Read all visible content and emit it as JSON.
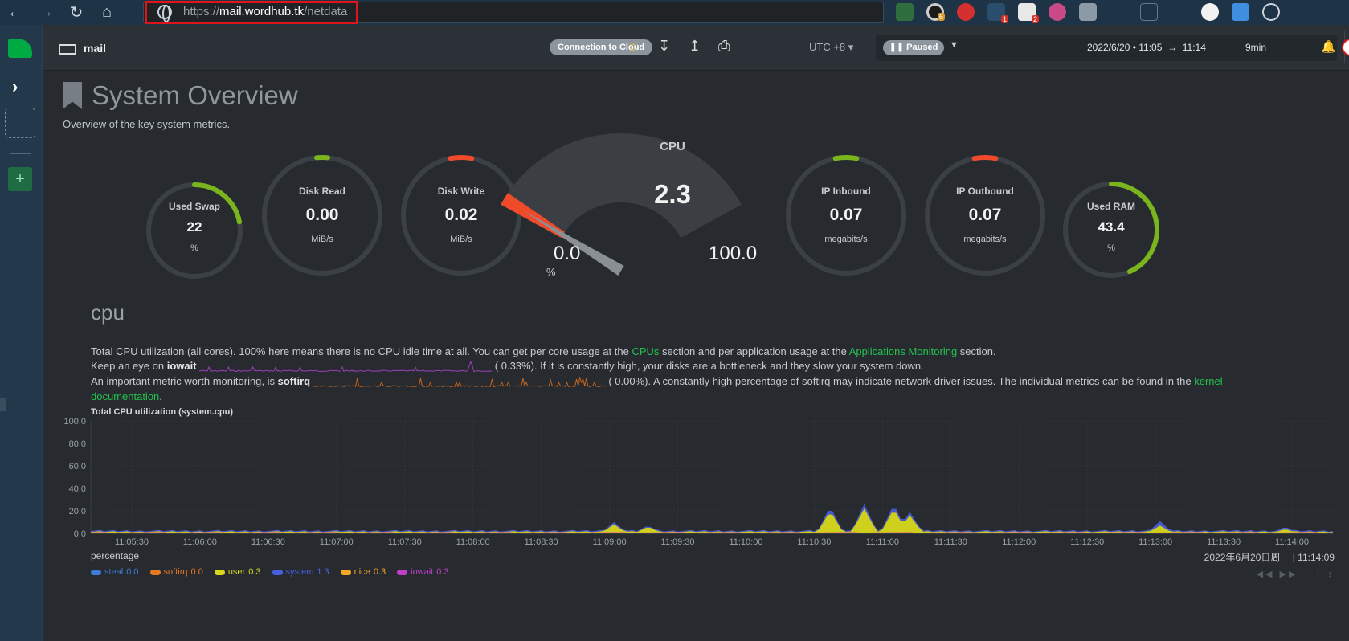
{
  "browser": {
    "url_domain": "mail.wordhub.tk",
    "url_prefix": "https://",
    "url_path": "/netdata",
    "extension_badges": [
      "6",
      "1",
      "2"
    ]
  },
  "header": {
    "host": "mail",
    "cloud_button": "Connection to Cloud",
    "timezone": "UTC +8",
    "paused_label": "Paused",
    "time_range_start": "2022/6/20 • 11:05",
    "time_range_arrow": "→",
    "time_range_end": "11:14",
    "duration": "9min"
  },
  "page": {
    "title": "System Overview",
    "subtitle": "Overview of the key system metrics."
  },
  "gauges": {
    "used_swap": {
      "label": "Used Swap",
      "value": "22",
      "unit": "%",
      "fraction": 0.22,
      "color": "#7ab51d"
    },
    "disk_read": {
      "label": "Disk Read",
      "value": "0.00",
      "unit": "MiB/s",
      "fraction": 0.0,
      "color": "#7ab51d"
    },
    "disk_write": {
      "label": "Disk Write",
      "value": "0.02",
      "unit": "MiB/s",
      "fraction": 0.04,
      "color": "#ef4b2b"
    },
    "cpu": {
      "label": "CPU",
      "value": "2.3",
      "min": "0.0",
      "max": "100.0",
      "unit": "%",
      "fraction": 0.023
    },
    "ip_inbound": {
      "label": "IP Inbound",
      "value": "0.07",
      "unit": "megabits/s",
      "fraction": 0.04,
      "color": "#7ab51d"
    },
    "ip_outbound": {
      "label": "IP Outbound",
      "value": "0.07",
      "unit": "megabits/s",
      "fraction": 0.04,
      "color": "#ef4b2b"
    },
    "used_ram": {
      "label": "Used RAM",
      "value": "43.4",
      "unit": "%",
      "fraction": 0.434,
      "color": "#7ab51d"
    }
  },
  "cpu_section": {
    "title": "cpu",
    "line1_a": "Total CPU utilization (all cores). 100% here means there is no CPU idle time at all. You can get per core usage at the ",
    "line1_link1": "CPUs",
    "line1_b": " section and per application usage at the ",
    "line1_link2": "Applications Monitoring",
    "line1_c": " section.",
    "line2_a": "Keep an eye on ",
    "line2_bold": "iowait",
    "line2_value": "(      0.33%). If it is constantly high, your disks are a bottleneck and they slow your system down.",
    "line3_a": "An important metric worth monitoring, is ",
    "line3_bold": "softirq",
    "line3_value": "(      0.00%). A constantly high percentage of softirq may indicate network driver issues. The individual metrics can be found in the ",
    "line3_link": "kernel",
    "line4_link": "documentation",
    "line4_end": "."
  },
  "chart_data": {
    "type": "area",
    "title": "Total CPU utilization (system.cpu)",
    "ylabel": "percentage",
    "ylim": [
      0,
      100
    ],
    "yticks": [
      "100.0",
      "80.0",
      "60.0",
      "40.0",
      "20.0",
      "0.0"
    ],
    "x": [
      "11:05:30",
      "11:06:00",
      "11:06:30",
      "11:07:00",
      "11:07:30",
      "11:08:00",
      "11:08:30",
      "11:09:00",
      "11:09:30",
      "11:10:00",
      "11:10:30",
      "11:11:00",
      "11:11:30",
      "11:12:00",
      "11:12:30",
      "11:13:00",
      "11:13:30",
      "11:14:00"
    ],
    "date_label": "2022年6月20日周一 | 11:14:09",
    "series": [
      {
        "name": "steal",
        "value": "0.0",
        "color": "#3e7bd6"
      },
      {
        "name": "softirq",
        "value": "0.0",
        "color": "#e87722"
      },
      {
        "name": "user",
        "value": "0.3",
        "color": "#d8d81c"
      },
      {
        "name": "system",
        "value": "1.3",
        "color": "#4a5fe0"
      },
      {
        "name": "nice",
        "value": "0.3",
        "color": "#f5a623"
      },
      {
        "name": "iowait",
        "value": "0.3",
        "color": "#c13fc6"
      }
    ],
    "spikes": [
      {
        "t": "11:09:02",
        "user": 8,
        "system": 2
      },
      {
        "t": "11:09:17",
        "user": 6,
        "system": 1
      },
      {
        "t": "11:10:37",
        "user": 20,
        "system": 4
      },
      {
        "t": "11:10:52",
        "user": 22,
        "system": 4
      },
      {
        "t": "11:11:05",
        "user": 22,
        "system": 4
      },
      {
        "t": "11:11:12",
        "user": 16,
        "system": 3
      },
      {
        "t": "11:13:02",
        "user": 7,
        "system": 4
      },
      {
        "t": "11:13:57",
        "user": 4,
        "system": 2
      }
    ]
  }
}
